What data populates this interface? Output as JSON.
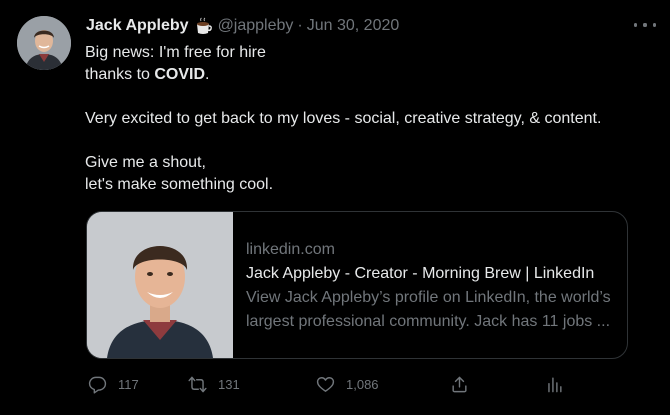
{
  "tweet": {
    "author_name": "Jack Appleby",
    "author_emoji": "coffee-emoji",
    "handle": "@jappleby",
    "separator": "·",
    "date": "Jun 30, 2020",
    "text": {
      "line1": "Big news: I'm free for hire",
      "line2_prefix": "thanks to ",
      "line2_bold": "COVID",
      "line2_suffix": ".",
      "line3": "Very excited to get back to my loves - social, creative strategy, & content.",
      "line4": "Give me a shout,",
      "line5": "let's make something cool."
    }
  },
  "card": {
    "domain": "linkedin.com",
    "title": "Jack Appleby - Creator - Morning Brew | LinkedIn",
    "description_line1": "View Jack Appleby’s profile on LinkedIn, the world’s",
    "description_line2": "largest professional community. Jack has 11 jobs ..."
  },
  "actions": {
    "reply": {
      "icon": "reply-icon",
      "count": "117"
    },
    "retweet": {
      "icon": "retweet-icon",
      "count": "131"
    },
    "like": {
      "icon": "heart-icon",
      "count": "1,086"
    },
    "share": {
      "icon": "share-icon"
    },
    "analytics": {
      "icon": "analytics-icon"
    }
  },
  "colors": {
    "background": "#000000",
    "text": "#e7e9ea",
    "secondary": "#71767b",
    "border": "#2f3336"
  }
}
